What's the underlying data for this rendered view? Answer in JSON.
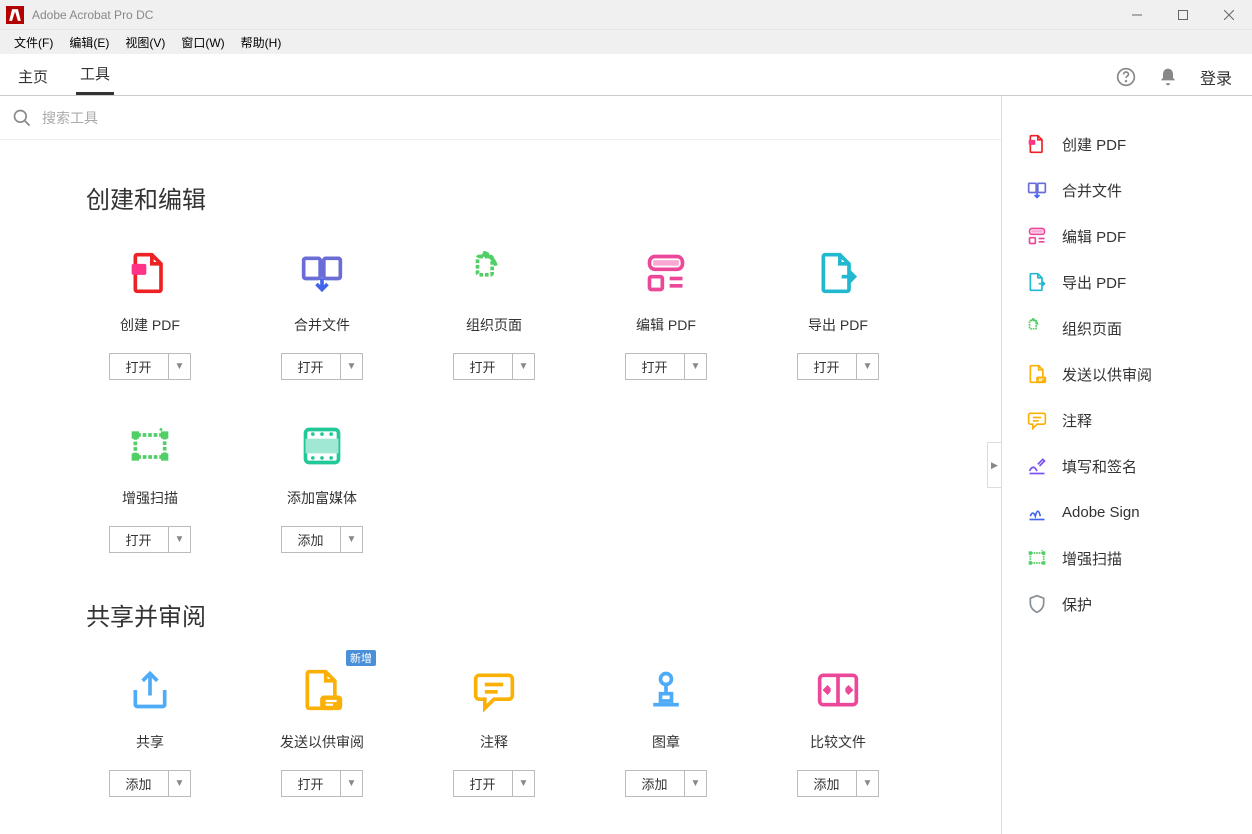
{
  "app": {
    "title": "Adobe Acrobat Pro DC"
  },
  "menu": {
    "items": [
      "文件(F)",
      "编辑(E)",
      "视图(V)",
      "窗口(W)",
      "帮助(H)"
    ]
  },
  "tabs": {
    "home": "主页",
    "tools": "工具",
    "login": "登录"
  },
  "search": {
    "placeholder": "搜索工具"
  },
  "labels": {
    "open": "打开",
    "add": "添加",
    "new_badge": "新增"
  },
  "sections": [
    {
      "title": "创建和编辑",
      "tools": [
        {
          "label": "创建 PDF",
          "icon": "create-pdf",
          "action": "open"
        },
        {
          "label": "合并文件",
          "icon": "combine",
          "action": "open"
        },
        {
          "label": "组织页面",
          "icon": "organize",
          "action": "open"
        },
        {
          "label": "编辑 PDF",
          "icon": "edit-pdf",
          "action": "open"
        },
        {
          "label": "导出 PDF",
          "icon": "export-pdf",
          "action": "open"
        },
        {
          "label": "增强扫描",
          "icon": "enhance-scan",
          "action": "open"
        },
        {
          "label": "添加富媒体",
          "icon": "rich-media",
          "action": "add"
        }
      ]
    },
    {
      "title": "共享并审阅",
      "tools": [
        {
          "label": "共享",
          "icon": "share",
          "action": "add"
        },
        {
          "label": "发送以供审阅",
          "icon": "send-review",
          "action": "open",
          "badge": "new"
        },
        {
          "label": "注释",
          "icon": "comment",
          "action": "open"
        },
        {
          "label": "图章",
          "icon": "stamp",
          "action": "add"
        },
        {
          "label": "比较文件",
          "icon": "compare",
          "action": "add"
        }
      ]
    }
  ],
  "shortcuts": [
    {
      "label": "创建 PDF",
      "icon": "create-pdf",
      "color": "#ed2224"
    },
    {
      "label": "合并文件",
      "icon": "combine",
      "color": "#6a6dd6"
    },
    {
      "label": "编辑 PDF",
      "icon": "edit-pdf",
      "color": "#ec4899"
    },
    {
      "label": "导出 PDF",
      "icon": "export-pdf",
      "color": "#22b8cf"
    },
    {
      "label": "组织页面",
      "icon": "organize",
      "color": "#51cf66"
    },
    {
      "label": "发送以供审阅",
      "icon": "send-review",
      "color": "#fab005"
    },
    {
      "label": "注释",
      "icon": "comment",
      "color": "#fab005"
    },
    {
      "label": "填写和签名",
      "icon": "fill-sign",
      "color": "#7950f2"
    },
    {
      "label": "Adobe Sign",
      "icon": "adobe-sign",
      "color": "#4263eb"
    },
    {
      "label": "增强扫描",
      "icon": "enhance-scan",
      "color": "#51cf66"
    },
    {
      "label": "保护",
      "icon": "protect",
      "color": "#868e96"
    }
  ]
}
